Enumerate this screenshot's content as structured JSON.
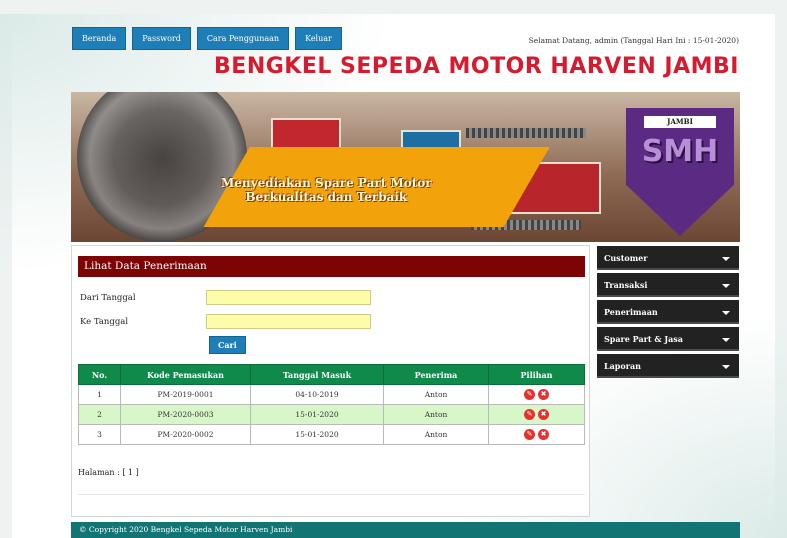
{
  "nav": {
    "items": [
      "Beranda",
      "Password",
      "Cara Penggunaan",
      "Keluar"
    ]
  },
  "header": {
    "welcome": "Selamat Datang, admin (Tanggal Hari Ini : 15-01-2020)",
    "brand": "Bengkel Sepeda Motor Harven Jambi"
  },
  "banner": {
    "tagline_line1": "Menyediakan Spare Part Motor",
    "tagline_line2": "Berkualitas dan Terbaik",
    "logo_top": "JAMBI",
    "logo_text": "SMH"
  },
  "main": {
    "title": "Lihat Data Penerimaan",
    "from_label": "Dari Tanggal",
    "to_label": "Ke Tanggal",
    "from_value": "",
    "to_value": "",
    "search_label": "Cari",
    "columns": [
      "No.",
      "Kode Pemasukan",
      "Tanggal Masuk",
      "Penerima",
      "Pilihan"
    ],
    "rows": [
      {
        "no": "1",
        "kode": "PM-2019-0001",
        "tanggal": "04-10-2019",
        "penerima": "Anton"
      },
      {
        "no": "2",
        "kode": "PM-2020-0003",
        "tanggal": "15-01-2020",
        "penerima": "Anton"
      },
      {
        "no": "3",
        "kode": "PM-2020-0002",
        "tanggal": "15-01-2020",
        "penerima": "Anton"
      }
    ],
    "pagination": "Halaman : [ 1 ]"
  },
  "sidebar": {
    "items": [
      "Customer",
      "Transaksi",
      "Penerimaan",
      "Spare Part & Jasa",
      "Laporan"
    ]
  },
  "footer": {
    "text": "© Copyright 2020 Bengkel Sepeda Motor Harven Jambi"
  },
  "colors": {
    "nav_button": "#1e7fb8",
    "brand_red": "#d71a2e",
    "section_title": "#7d0404",
    "table_header": "#0f8a4a",
    "row_alt": "#d8f7c8",
    "footer": "#137474"
  },
  "icons": {
    "edit": "pencil-icon",
    "delete": "trash-icon",
    "sidebar_expand": "chevron-down-icon"
  }
}
